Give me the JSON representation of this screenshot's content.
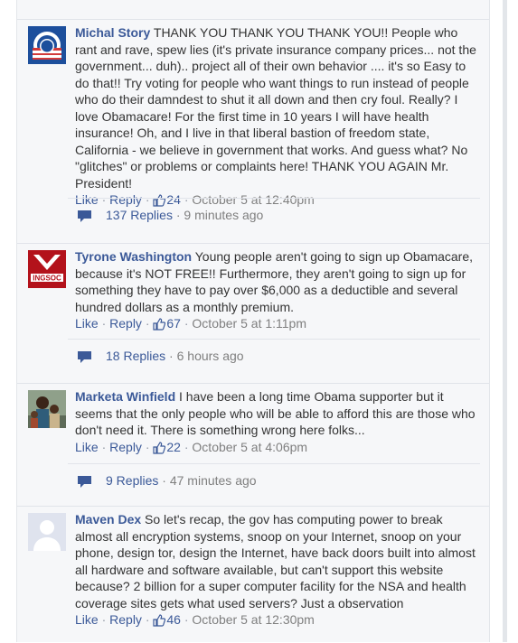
{
  "comments": [
    {
      "author": "Michal Story",
      "text": "THANK YOU THANK YOU THANK YOU!! People who rant and rave, spew lies (it's private insurance company prices... not the government... duh).. project all of their own behavior .... it's so Easy to do that!! Try voting for people who want things to run instead of people who do their damndest to shut it all down and then cry foul. Really? I love Obamacare! For the first time in 10 years I will have health insurance! Oh, and I live in that liberal bastion of freedom state, California - we believe in government that works. And guess what? No \"glitches\" or problems or complaints here! THANK YOU AGAIN Mr. President!",
      "like_label": "Like",
      "reply_label": "Reply",
      "likes": "24",
      "timestamp": "October 5 at 12:40pm",
      "replies_count": "137 Replies",
      "replies_time": "9 minutes ago",
      "avatar_icon": "obama-logo-icon"
    },
    {
      "author": "Tyrone Washington",
      "text": "Young people aren't going to sign up Obamacare, because it's NOT FREE!! Furthermore, they aren't going to sign up for something they have to pay over $6,000 as a deductible and several hundred dollars as a monthly premium.",
      "like_label": "Like",
      "reply_label": "Reply",
      "likes": "67",
      "timestamp": "October 5 at 1:11pm",
      "replies_count": "18 Replies",
      "replies_time": "6 hours ago",
      "avatar_text": "INGSOC",
      "avatar_icon": "ingsoc-logo-icon"
    },
    {
      "author": "Marketa Winfield",
      "text": "I have been a long time Obama supporter but it seems that the only people who will be able to afford this are those who don't need it. There is something wrong here folks...",
      "like_label": "Like",
      "reply_label": "Reply",
      "likes": "22",
      "timestamp": "October 5 at 4:06pm",
      "replies_count": "9 Replies",
      "replies_time": "47 minutes ago",
      "avatar_icon": "family-photo-icon"
    },
    {
      "author": "Maven Dex",
      "text": "So let's recap, the gov has computing power to break almost all encryption systems, snoop on your Internet, snoop on your phone, design tor, design the Internet, have back doors built into almost all hardware and software available, but can't support this website because? 2 billion for a super computer facility for the NSA and health coverage sites gets what used servers? Just a observation",
      "like_label": "Like",
      "reply_label": "Reply",
      "likes": "46",
      "timestamp": "October 5 at 12:30pm",
      "avatar_icon": "default-avatar-icon"
    }
  ],
  "separator": "·",
  "colors": {
    "link": "#3b5998",
    "meta": "#7f7f7f",
    "background": "#f6f7f9"
  }
}
